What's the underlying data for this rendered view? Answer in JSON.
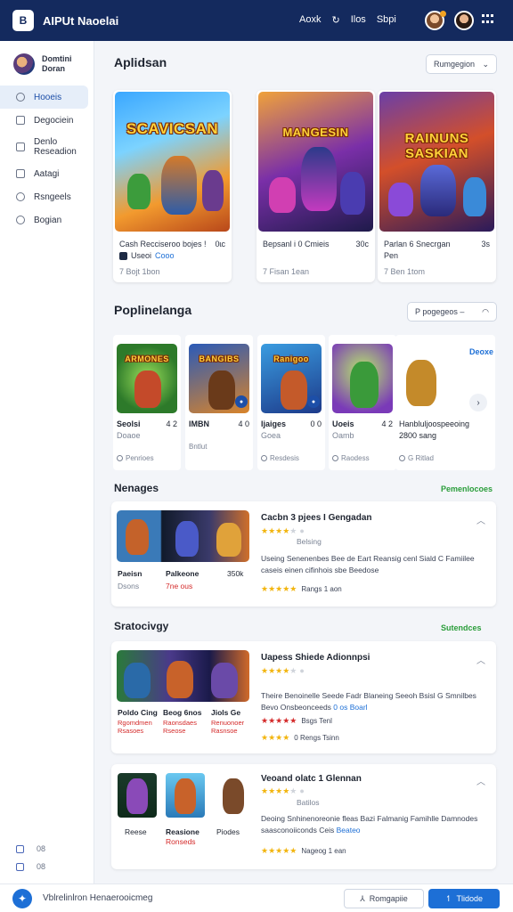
{
  "header": {
    "logo": "B",
    "title": "AIPUt Naoelai",
    "nav": [
      "Aoxk",
      "Ilos",
      "Sbpi"
    ],
    "refresh_icon": "refresh-icon"
  },
  "sidebar": {
    "profile_name": "Domtini\nDoran",
    "items": [
      {
        "label": "Hooeis",
        "icon": "user-icon"
      },
      {
        "label": "Degociein",
        "icon": "document-icon"
      },
      {
        "label": "Denlo\nReseadion",
        "icon": "bookmark-icon"
      },
      {
        "label": "Aatagi",
        "icon": "folder-icon"
      },
      {
        "label": "Rsngeels",
        "icon": "settings-icon"
      },
      {
        "label": "Bogian",
        "icon": "clock-icon"
      }
    ],
    "bottom": [
      "08",
      "08"
    ]
  },
  "section1": {
    "title": "Aplidsan",
    "dropdown": "Rumgegion"
  },
  "big_cards": [
    {
      "art_title": "SCAVICSAN",
      "name": "Cash Recciseroo bojes !",
      "price": "0ɩc",
      "tag": "Useoi",
      "tag_link": "Cooo",
      "meta": "7 Bojt 1bon"
    },
    {
      "art_title": "MANGESIN",
      "name": "Bepsanl i 0 Cmieis",
      "price": "30c",
      "tag": "",
      "tag_link": "",
      "meta": "7 Fisan 1ean"
    },
    {
      "art_title": "RAINUNS SASKIAN",
      "name": "Parlan 6 Snecrgan",
      "price": "3s",
      "tag": "Pen",
      "tag_link": "",
      "meta": "7 Ben 1tom"
    }
  ],
  "section2": {
    "title": "Poplinelanga",
    "dropdown": "P pogegeos –"
  },
  "small_cards": [
    {
      "art_title": "ARMONES",
      "name": "Seolsi",
      "score": "4 2",
      "sub": "Doaoe",
      "foot": "Penrioes"
    },
    {
      "art_title": "BANGIBS",
      "name": "IMBN",
      "score": "4 0",
      "sub": "",
      "foot": "Bntlut"
    },
    {
      "art_title": "Ranigoo",
      "name": "Ijaiges",
      "score": "0 0",
      "sub": "Goea",
      "foot": "Resdesis"
    },
    {
      "art_title": "",
      "name": "Uoeis",
      "score": "4 2",
      "sub": "Oamb",
      "foot": "Raodess"
    },
    {
      "art_title": "",
      "name": "Hanbluljoospeeoing",
      "score": "",
      "sub": "2800 sang",
      "foot": "G Ritlad"
    }
  ],
  "small_cards_link": "Deoxe",
  "section3": {
    "title": "Nenages",
    "link": "Pemenlocoes"
  },
  "review1": {
    "title": "Cacbn 3 pjees I Gengadan",
    "stars": 4,
    "rating_sub": "Belsing",
    "text": "Useing Senenenbes Bee de Eart Reansig cenl Siald C Famiilee caseis einen cifinhois sbe Beedose",
    "text_link": "Beedose",
    "stars2": 5,
    "count": "Rangs 1 aon",
    "thumb_labels": [
      {
        "name": "Paeisn",
        "sub": "Dsons"
      },
      {
        "name": "Palkeone",
        "sub": "7ne ous"
      }
    ],
    "price": "350k"
  },
  "section4": {
    "title": "Sratocivgy",
    "link": "Sutendces"
  },
  "review2": {
    "title": "Uapess Shiede Adionnpsi",
    "stars": 4,
    "text": "Theire Benoinelle Seede Fadr Blaneing Seeoh Bsisl G Smnilbes Bevo Onsbeonceeds",
    "text_link": "0 os Boarl",
    "count_red": "Bsgs Tenl",
    "count2": "0 Rengs Tsinn",
    "thumb_labels": [
      {
        "name": "Poldo Cing",
        "sub": "Rgomdmen\nRsasoes"
      },
      {
        "name": "Beog 6nos",
        "sub": "Raonsdaes\nRseose"
      },
      {
        "name": "Jiols Ge",
        "sub": "Renuonoer\nRasnsoe"
      }
    ]
  },
  "review3": {
    "title": "Veoand olatc 1 Glennan",
    "stars": 4,
    "rating_sub": "Batilos",
    "text": "Deoing Snhinenoreonie fleas Bazi Falmanig Famihlle Damnodes saasconoiiconds Ceis",
    "text_link": "Beateo",
    "count": "Nageog 1 ean",
    "thumb_labels": [
      {
        "name": "Reese",
        "sub": ""
      },
      {
        "name": "Reasione",
        "sub": "Ronseds"
      },
      {
        "name": "Piodes",
        "sub": ""
      }
    ]
  },
  "footer": {
    "logo": "✦",
    "text": "Vblrelinlron Henaerooicmeg",
    "secondary_btn": "Romgapiie",
    "primary_btn": "Tlidode"
  },
  "colors": {
    "header_bg": "#142a5e",
    "accent": "#1d6fd6",
    "star": "#f2b50f",
    "green": "#2a9d3a",
    "red": "#d42a2a"
  }
}
